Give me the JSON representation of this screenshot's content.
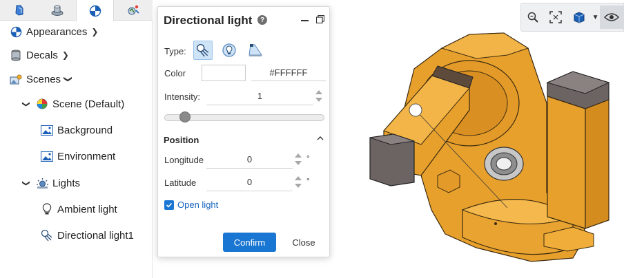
{
  "left_panel": {
    "tabs": [
      {
        "icon": "part-icon"
      },
      {
        "icon": "assembly-icon"
      },
      {
        "icon": "appearance-tab-icon",
        "active": true
      },
      {
        "icon": "analysis-icon"
      }
    ],
    "tree": {
      "appearances": "Appearances",
      "decals": "Decals",
      "scenes": "Scenes",
      "scene_default": "Scene (Default)",
      "background": "Background",
      "environment": "Environment",
      "lights": "Lights",
      "ambient_light": "Ambient light",
      "directional_light1": "Directional light1"
    }
  },
  "dialog": {
    "title": "Directional light",
    "type_label": "Type:",
    "color_label": "Color",
    "color_value": "#FFFFFF",
    "intensity_label": "Intensity:",
    "intensity_value": "1",
    "intensity_slider_fraction": 0.1,
    "position_title": "Position",
    "longitude_label": "Longitude",
    "longitude_value": "0",
    "latitude_label": "Latitude",
    "latitude_value": "0",
    "degree_unit": "°",
    "open_light_label": "Open light",
    "open_light_checked": true,
    "confirm_label": "Confirm",
    "close_label": "Close"
  },
  "viewport": {
    "toolbar": [
      "zoom-icon",
      "zoom-fit-icon",
      "view-cube-icon",
      "chevron-down-icon",
      "visibility-icon"
    ]
  },
  "colors": {
    "accent": "#1976d2",
    "model": "#e8a02c",
    "motor": "#6b6463"
  }
}
